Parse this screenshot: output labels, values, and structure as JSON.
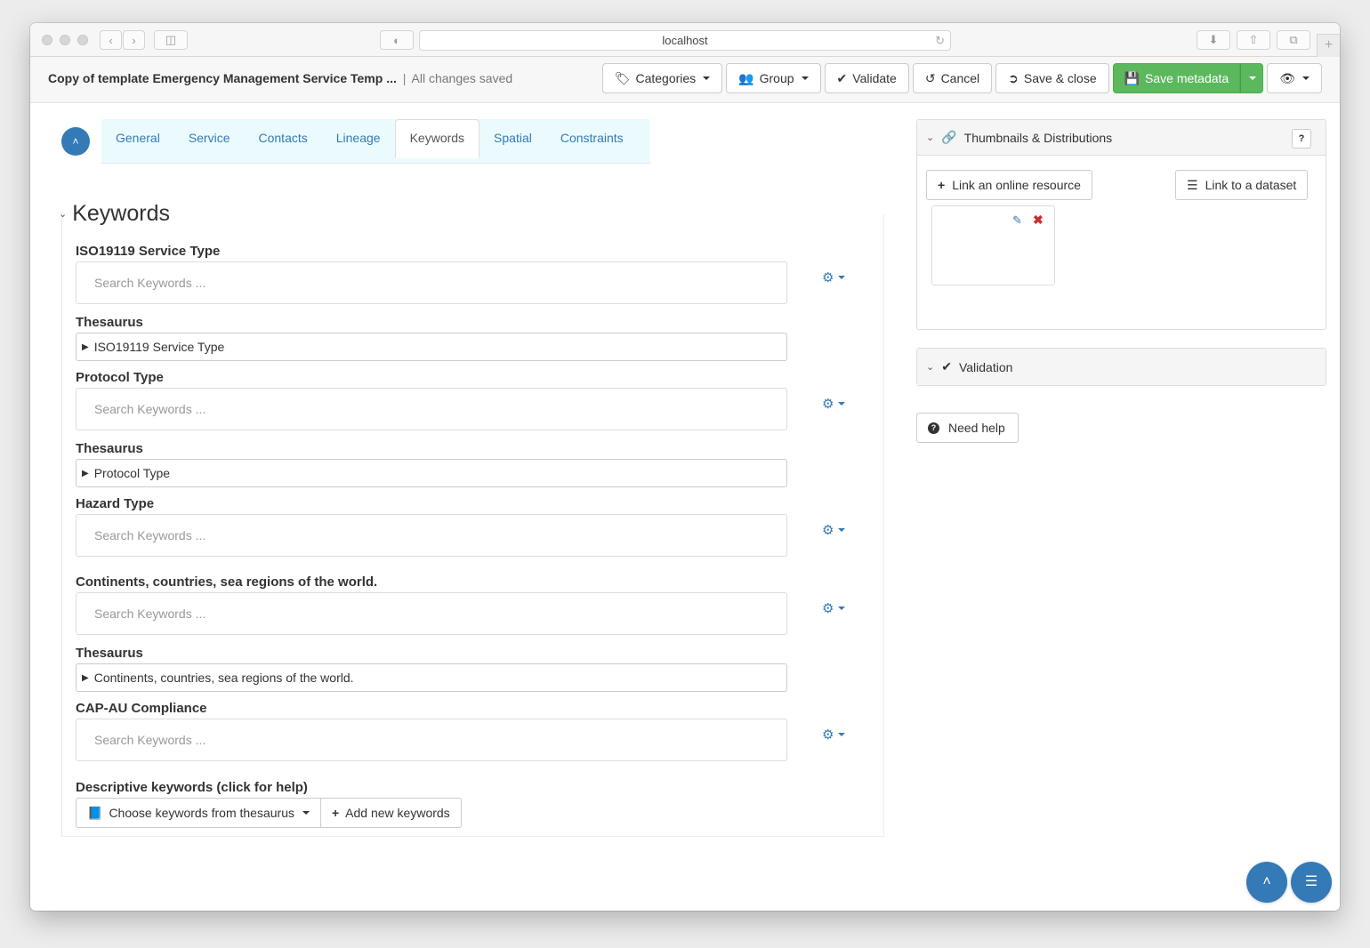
{
  "browser": {
    "url": "localhost"
  },
  "topbar": {
    "title": "Copy of template Emergency Management Service Temp ...",
    "separator": "|",
    "status": "All changes saved",
    "buttons": {
      "categories": "Categories",
      "group": "Group",
      "validate": "Validate",
      "cancel": "Cancel",
      "save_close": "Save & close",
      "save_metadata": "Save metadata"
    },
    "colors": {
      "save_green": "#5cb85c",
      "accent_blue": "#337ab7"
    }
  },
  "tabs": [
    {
      "label": "General",
      "active": false
    },
    {
      "label": "Service",
      "active": false
    },
    {
      "label": "Contacts",
      "active": false
    },
    {
      "label": "Lineage",
      "active": false
    },
    {
      "label": "Keywords",
      "active": true
    },
    {
      "label": "Spatial",
      "active": false
    },
    {
      "label": "Constraints",
      "active": false
    }
  ],
  "section": {
    "title": "Keywords",
    "fields": [
      {
        "label": "ISO19119 Service Type",
        "placeholder": "Search Keywords ...",
        "thesaurus_label": "Thesaurus",
        "thesaurus": "ISO19119 Service Type"
      },
      {
        "label": "Protocol Type",
        "placeholder": "Search Keywords ...",
        "thesaurus_label": "Thesaurus",
        "thesaurus": "Protocol Type"
      },
      {
        "label": "Hazard Type",
        "placeholder": "Search Keywords ..."
      },
      {
        "label": "Continents, countries, sea regions of the world.",
        "placeholder": "Search Keywords ...",
        "thesaurus_label": "Thesaurus",
        "thesaurus": "Continents, countries, sea regions of the world."
      },
      {
        "label": "CAP-AU Compliance",
        "placeholder": "Search Keywords ..."
      }
    ],
    "descriptive": {
      "label": "Descriptive keywords (click for help)",
      "choose_button": "Choose keywords from thesaurus",
      "add_button": "Add new keywords"
    }
  },
  "sidebar": {
    "thumbnails_panel": {
      "title": "Thumbnails & Distributions",
      "link_online": "Link an online resource",
      "link_dataset": "Link to a dataset"
    },
    "validation_panel": {
      "title": "Validation"
    },
    "need_help": "Need help"
  }
}
